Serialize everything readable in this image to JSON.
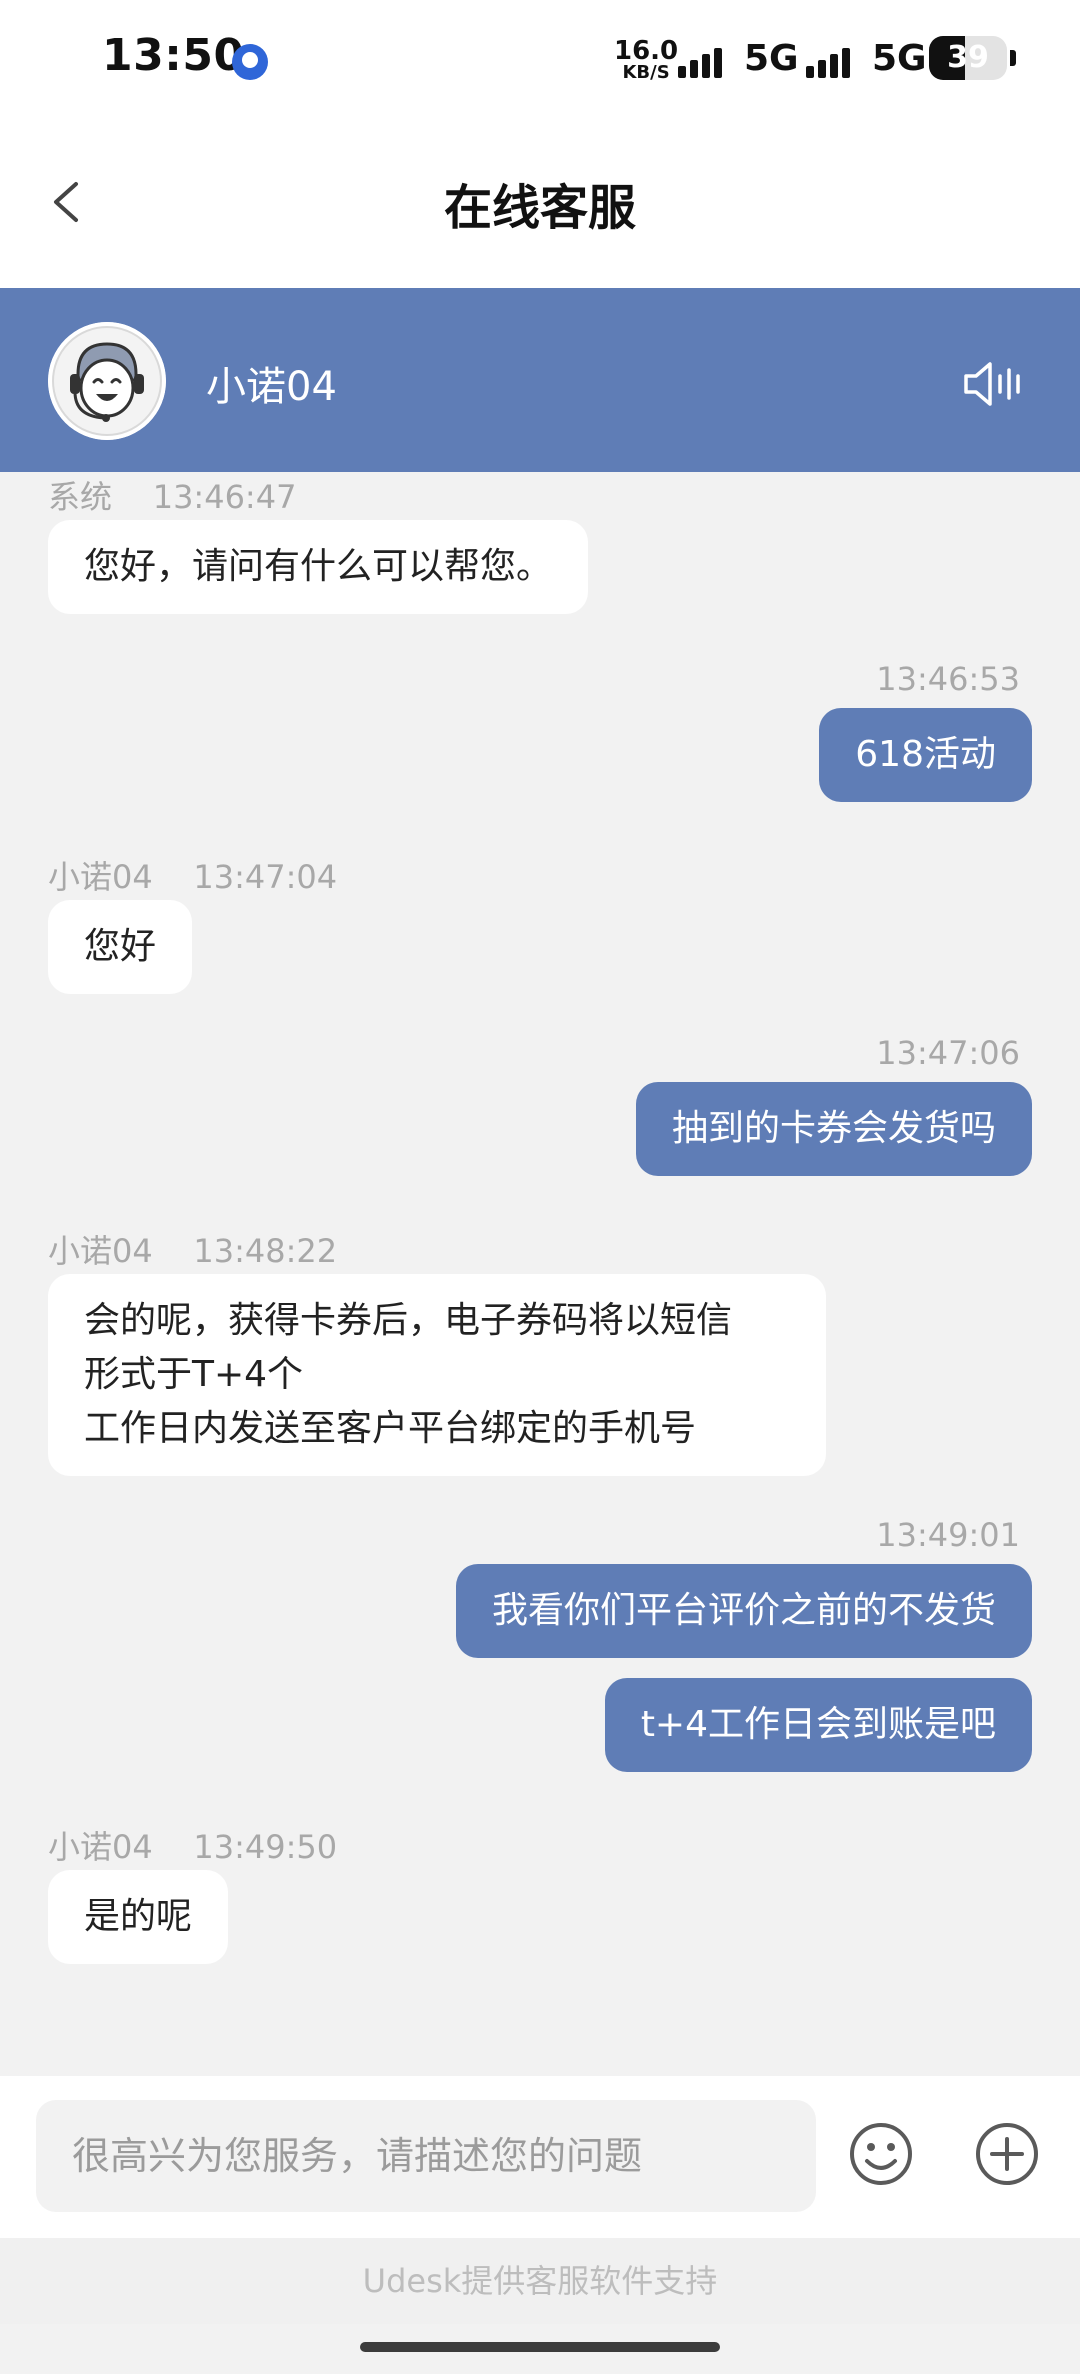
{
  "status": {
    "time": "13:50",
    "speed_value": "16.0",
    "speed_unit": "KB/S",
    "net1": "5G",
    "net2": "5G",
    "battery": "39"
  },
  "header": {
    "title": "在线客服",
    "agent_name": "小诺04"
  },
  "messages": [
    {
      "sender": "系统",
      "time": "13:46:47",
      "text": "您好，请问有什么可以帮您。"
    },
    {
      "time": "13:46:53",
      "text": "618活动"
    },
    {
      "sender": "小诺04",
      "time": "13:47:04",
      "text": "您好"
    },
    {
      "time": "13:47:06",
      "text": "抽到的卡券会发货吗"
    },
    {
      "sender": "小诺04",
      "time": "13:48:22",
      "lines": [
        "会的呢，获得卡券后，电子券码将以短信",
        "形式于T+4个",
        "工作日内发送至客户平台绑定的手机号"
      ]
    },
    {
      "time": "13:49:01",
      "text": "我看你们平台评价之前的不发货"
    },
    {
      "text": "t+4工作日会到账是吧"
    },
    {
      "sender": "小诺04",
      "time": "13:49:50",
      "text": "是的呢"
    }
  ],
  "input": {
    "placeholder": "很高兴为您服务，请描述您的问题"
  },
  "footer": {
    "text": "Udesk提供客服软件支持"
  },
  "colors": {
    "accent": "#5f7db6",
    "background": "#f2f2f2"
  },
  "icons": [
    "back-icon",
    "agent-avatar",
    "sound-icon",
    "emoji-icon",
    "plus-icon"
  ]
}
